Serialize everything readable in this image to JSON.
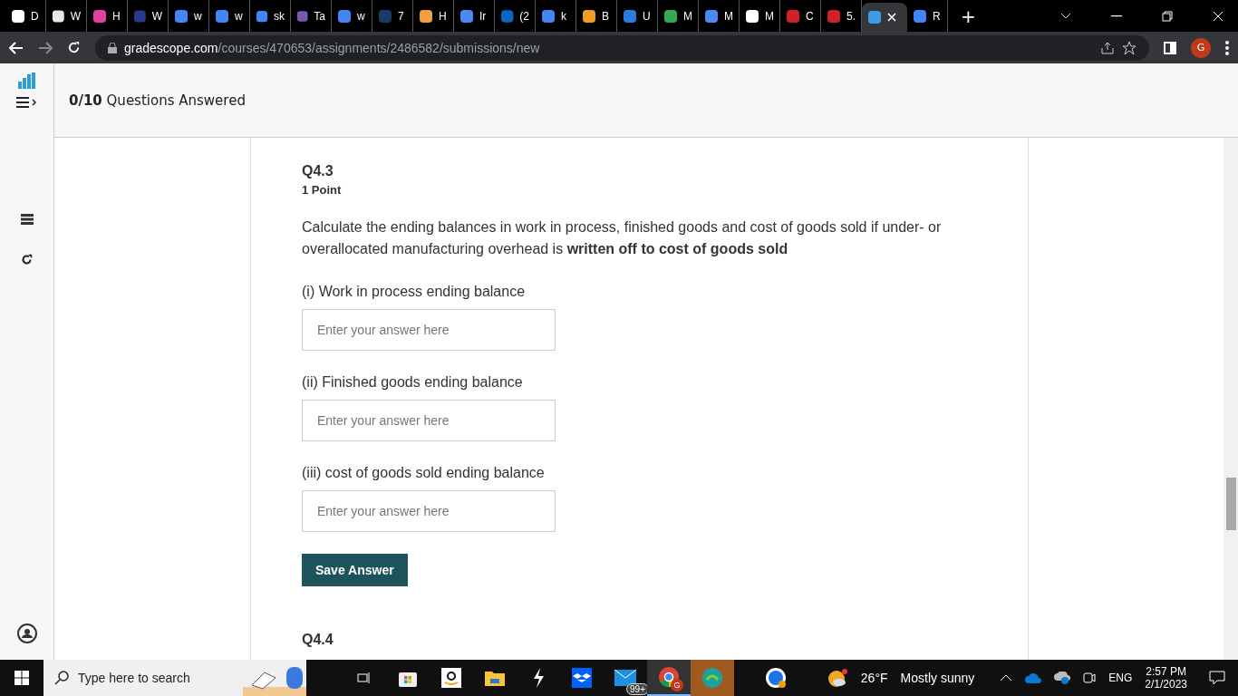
{
  "browser": {
    "tabs": [
      {
        "label": "D",
        "selected": false,
        "color": "#ffffff"
      },
      {
        "label": "W",
        "selected": false,
        "color": "#e8e8e8"
      },
      {
        "label": "H",
        "selected": false,
        "color": "#e040a0"
      },
      {
        "label": "W",
        "selected": false,
        "color": "#2a3a8a"
      },
      {
        "label": "w",
        "selected": false,
        "color": "#4285f4"
      },
      {
        "label": "w",
        "selected": false,
        "color": "#4285f4"
      },
      {
        "label": "sk",
        "selected": false,
        "color": "#4285f4"
      },
      {
        "label": "Ta",
        "selected": false,
        "color": "#7a5ab0"
      },
      {
        "label": "w",
        "selected": false,
        "color": "#4285f4"
      },
      {
        "label": "7",
        "selected": false,
        "color": "#1a3a6a"
      },
      {
        "label": "H",
        "selected": false,
        "color": "#f0a040"
      },
      {
        "label": "Ir",
        "selected": false,
        "color": "#4a8af4"
      },
      {
        "label": "(2",
        "selected": false,
        "color": "#0a66c2"
      },
      {
        "label": "k",
        "selected": false,
        "color": "#4285f4"
      },
      {
        "label": "B",
        "selected": false,
        "color": "#f0a020"
      },
      {
        "label": "U",
        "selected": false,
        "color": "#2a7ae0"
      },
      {
        "label": "M",
        "selected": false,
        "color": "#34a853"
      },
      {
        "label": "M",
        "selected": false,
        "color": "#4a8af4"
      },
      {
        "label": "M",
        "selected": false,
        "color": "#ffffff"
      },
      {
        "label": "C",
        "selected": false,
        "color": "#d0202a"
      },
      {
        "label": "5.",
        "selected": false,
        "color": "#d0202a"
      },
      {
        "selected": true,
        "color": "#3d9be9"
      },
      {
        "label": "R",
        "selected": false,
        "color": "#4285f4"
      }
    ],
    "new_tab": "+",
    "url": {
      "domain": "gradescope.com",
      "path": "/courses/470653/assignments/2486582/submissions/new"
    },
    "profile": "G"
  },
  "header": {
    "progress": "**0/10** Questions Answered"
  },
  "question": {
    "number": "Q4.3",
    "points": "1 Point",
    "prompt": "Calculate the ending balances in work in process, finished goods and cost of goods sold if under- or overallocated manufacturing overhead is **written off to cost of goods sold**",
    "fields": [
      {
        "label": "(i) Work in process ending balance",
        "placeholder": "Enter your answer here"
      },
      {
        "label": "(ii) Finished goods ending balance",
        "placeholder": "Enter your answer here"
      },
      {
        "label": "(iii) cost of goods sold ending balance",
        "placeholder": "Enter your answer here"
      }
    ],
    "button": "Save Answer"
  },
  "next_question": {
    "number": "Q4.4"
  },
  "taskbar": {
    "search": {
      "placeholder": "Type here to search"
    },
    "mail_badge": "99+",
    "profile": "G",
    "weather": {
      "temp": "26°F",
      "condition": "Mostly sunny"
    },
    "language": "ENG",
    "time": "2:57 PM",
    "date": "2/1/2023"
  }
}
